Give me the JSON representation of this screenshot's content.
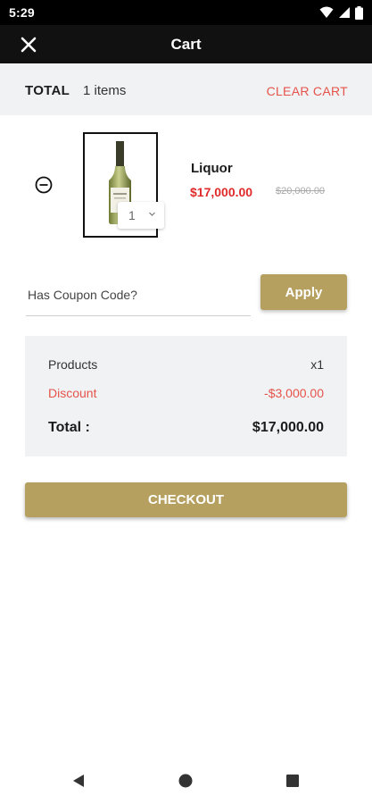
{
  "status_bar": {
    "time": "5:29",
    "icons": [
      "wifi-icon",
      "signal-icon",
      "battery-icon"
    ]
  },
  "app_bar": {
    "title": "Cart",
    "close_icon": "close-icon"
  },
  "cart_header": {
    "total_label": "TOTAL",
    "item_count": "1 items",
    "clear_cart_label": "CLEAR CART"
  },
  "cart_items": [
    {
      "name": "Liquor",
      "price": "$17,000.00",
      "original_price": "$20,000.00",
      "quantity": "1",
      "image": "wine-bottle"
    }
  ],
  "coupon": {
    "placeholder": "Has Coupon Code?",
    "value": "",
    "apply_label": "Apply"
  },
  "summary": {
    "products_label": "Products",
    "products_value": "x1",
    "discount_label": "Discount",
    "discount_value": "-$3,000.00",
    "total_label": "Total :",
    "total_value": "$17,000.00"
  },
  "checkout_label": "CHECKOUT",
  "colors": {
    "accent_gold": "#b5a060",
    "app_bar": "#111111",
    "price_red": "#e02a2a",
    "discount_red": "#e5534b",
    "panel_gray": "#f1f2f4"
  },
  "nav_bar": {
    "buttons": [
      "back-icon",
      "home-icon",
      "recents-icon"
    ]
  }
}
